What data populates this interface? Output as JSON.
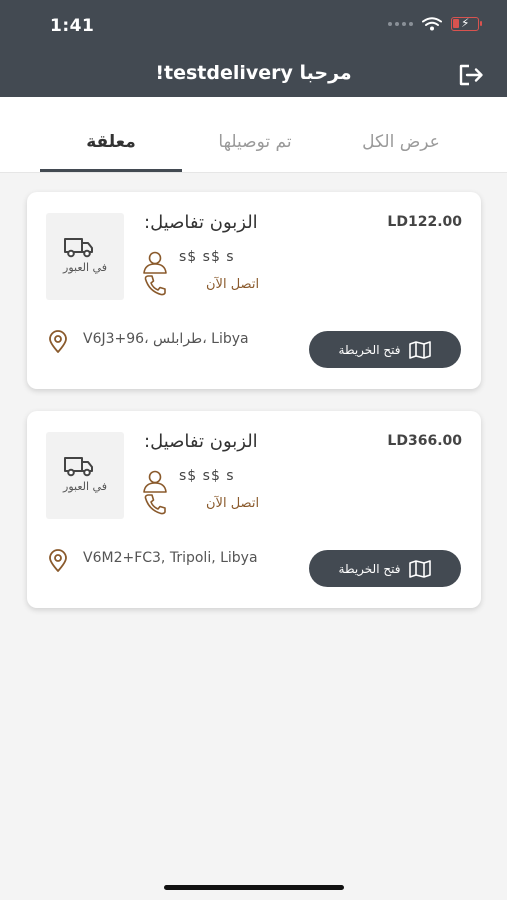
{
  "status_bar": {
    "time": "1:41"
  },
  "header": {
    "title": "مرحبا testdelivery!"
  },
  "tabs": [
    {
      "label": "عرض الكل"
    },
    {
      "label": "تم توصيلها"
    },
    {
      "label": "معلقة"
    }
  ],
  "orders": [
    {
      "price": "LD122.00",
      "delivery_status": "في العبور",
      "customer_title": "الزبون تفاصيل:",
      "customer_name": "s$ s$ s",
      "call_label": "اتصل الآن",
      "address": "V6J3+96، طرابلس، Libya",
      "map_button_label": "فتح الخريطة"
    },
    {
      "price": "LD366.00",
      "delivery_status": "في العبور",
      "customer_title": "الزبون تفاصيل:",
      "customer_name": "s$ s$ s",
      "call_label": "اتصل الآن",
      "address": "V6M2+FC3, Tripoli, Libya",
      "map_button_label": "فتح الخريطة"
    }
  ],
  "icons": {
    "logout": "logout-icon",
    "truck": "truck-icon",
    "person": "person-icon",
    "phone": "phone-icon",
    "pin": "location-pin-icon",
    "map": "map-icon"
  },
  "colors": {
    "header_bg": "#434a52",
    "accent_brown": "#8a5a2c",
    "background": "#f4f4f4"
  }
}
